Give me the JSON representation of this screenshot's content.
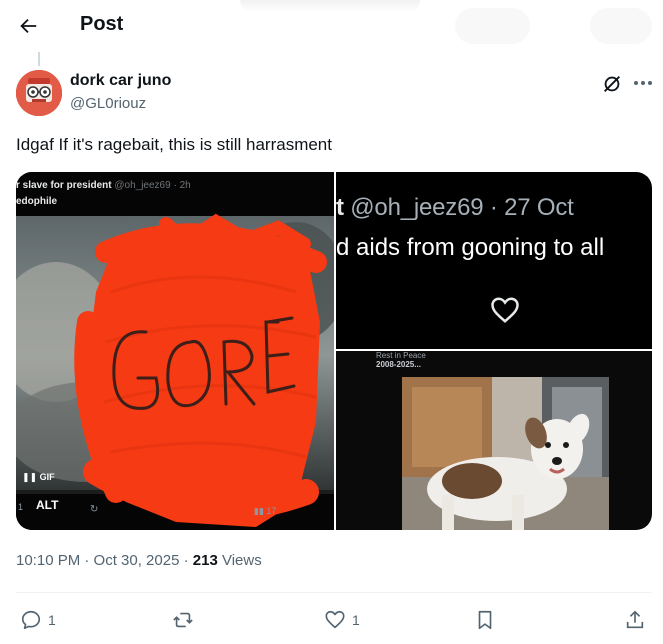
{
  "header": {
    "title": "Post",
    "back_icon": "arrow-left-icon"
  },
  "post": {
    "author_name": "dork car juno",
    "author_handle": "@GL0riouz",
    "text": "Idgaf If it's ragebait, this is still harrasment",
    "timestamp": "10:10 PM · Oct 30, 2025 · ",
    "views_count": "213",
    "views_label": " Views"
  },
  "media": {
    "left": {
      "embedded_name": "r slave for president",
      "embedded_handle": "@oh_jeez69 · 2h",
      "embedded_sub": "edophile",
      "overlay_text": "GORE",
      "gif_label": "GIF",
      "alt_label": "ALT",
      "stats_text": "17",
      "reply_count": "1"
    },
    "top_right": {
      "handle_prefix": "t",
      "handle_text": " @oh_jeez69 · 27 Oct",
      "body_text": "d aids from gooning to all"
    },
    "bottom_right": {
      "head1": "Rest in Peace",
      "head2": "2008-2025..."
    }
  },
  "actions": {
    "reply_count": "1",
    "like_count": "1"
  },
  "colors": {
    "text_primary": "#0f1419",
    "text_secondary": "#536471",
    "scribble_red": "#f53a14",
    "divider": "#eff3f4"
  },
  "icons": [
    "arrow-left-icon",
    "grok-icon",
    "more-icon",
    "reply-icon",
    "repost-icon",
    "like-icon",
    "bookmark-icon",
    "share-icon",
    "heart-icon"
  ]
}
